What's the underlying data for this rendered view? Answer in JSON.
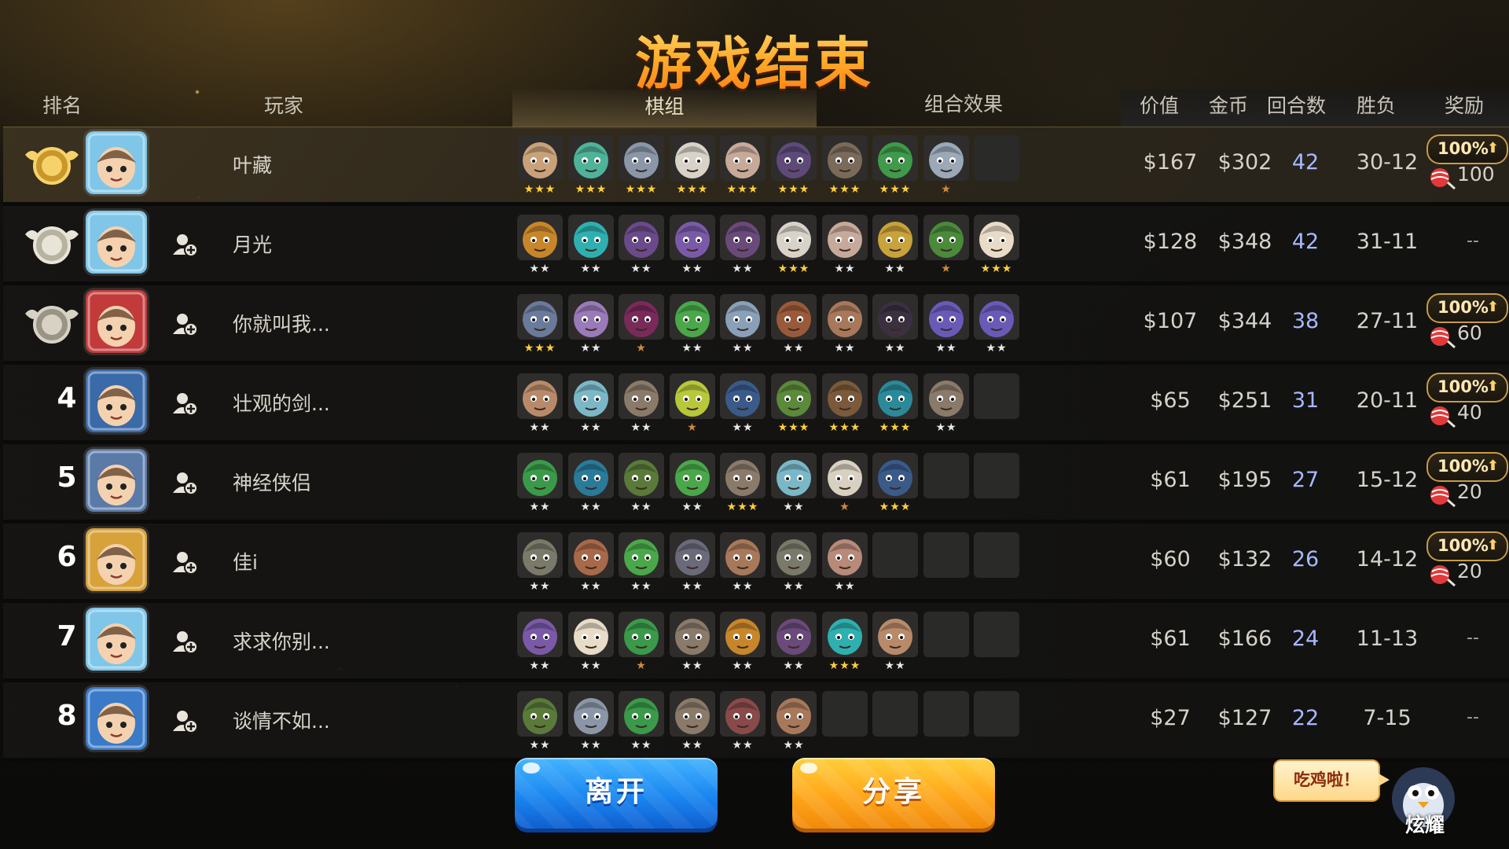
{
  "title": "游戏结束",
  "headers": {
    "rank": "排名",
    "player": "玩家",
    "lineup": "棋组",
    "synergy": "组合效果",
    "value": "价值",
    "gold": "金币",
    "rounds": "回合数",
    "winloss": "胜负",
    "reward": "奖励"
  },
  "colors": {
    "title_orange": "#ffa31e",
    "rounds_blue": "#a8b8ff",
    "star_gold": "#ffcf3a",
    "star_silver": "#e8e8e8",
    "star_bronze": "#d08a3a",
    "leave_blue": "#1a86f0",
    "share_orange": "#ffa61a"
  },
  "players": [
    {
      "rank": "1",
      "medal": "gold",
      "name": "叶藏",
      "value": "$167",
      "gold": "$302",
      "rounds": "42",
      "record": "30-12",
      "reward": {
        "pct": "100%",
        "amount": "100"
      },
      "avatar_color": "#7fc6e8",
      "pieces": [
        {
          "c": "#c9a27a",
          "s": 3
        },
        {
          "c": "#4fb39a",
          "s": 3
        },
        {
          "c": "#8b97a8",
          "s": 3
        },
        {
          "c": "#d8d2c8",
          "s": 3
        },
        {
          "c": "#c7a99a",
          "s": 3
        },
        {
          "c": "#5e4a7a",
          "s": 3
        },
        {
          "c": "#7a6a5a",
          "s": 3
        },
        {
          "c": "#3f9a4a",
          "s": 3
        },
        {
          "c": "#9aa8b8",
          "s": 1
        },
        null
      ]
    },
    {
      "rank": "2",
      "medal": "silver",
      "name": "月光",
      "value": "$128",
      "gold": "$348",
      "rounds": "42",
      "record": "31-11",
      "reward": null,
      "avatar_color": "#7fc6e8",
      "pieces": [
        {
          "c": "#c8862a",
          "s": 2
        },
        {
          "c": "#2fb0b0",
          "s": 2
        },
        {
          "c": "#6a4a8a",
          "s": 2
        },
        {
          "c": "#7a5aa8",
          "s": 2
        },
        {
          "c": "#6a4a7a",
          "s": 2
        },
        {
          "c": "#d8d2c8",
          "s": 3
        },
        {
          "c": "#c7a99a",
          "s": 2
        },
        {
          "c": "#c8a23a",
          "s": 2
        },
        {
          "c": "#4a8a3a",
          "s": 1
        },
        {
          "c": "#e8dcc8",
          "s": 3
        }
      ]
    },
    {
      "rank": "3",
      "medal": "bronze",
      "name": "你就叫我...",
      "value": "$107",
      "gold": "$344",
      "rounds": "38",
      "record": "27-11",
      "reward": {
        "pct": "100%",
        "amount": "60"
      },
      "avatar_color": "#c23a3a",
      "pieces": [
        {
          "c": "#6a7a9a",
          "s": 3
        },
        {
          "c": "#9a7ab8",
          "s": 2
        },
        {
          "c": "#7a2a5a",
          "s": 1
        },
        {
          "c": "#4aa84a",
          "s": 2
        },
        {
          "c": "#8aa0b8",
          "s": 2
        },
        {
          "c": "#9a5a3a",
          "s": 2
        },
        {
          "c": "#a8785a",
          "s": 2
        },
        {
          "c": "#3a3040",
          "s": 2
        },
        {
          "c": "#6a5ab8",
          "s": 2
        },
        {
          "c": "#6a5ab8",
          "s": 2
        }
      ]
    },
    {
      "rank": "4",
      "medal": null,
      "name": "壮观的剑...",
      "value": "$65",
      "gold": "$251",
      "rounds": "31",
      "record": "20-11",
      "reward": {
        "pct": "100%",
        "amount": "40"
      },
      "avatar_color": "#3a6aa8",
      "pieces": [
        {
          "c": "#b88a6a",
          "s": 2
        },
        {
          "c": "#7ab8c8",
          "s": 2
        },
        {
          "c": "#8a7a6a",
          "s": 2
        },
        {
          "c": "#b8c83a",
          "s": 1
        },
        {
          "c": "#3a5a8a",
          "s": 2
        },
        {
          "c": "#5a8a3a",
          "s": 3
        },
        {
          "c": "#7a5a3a",
          "s": 3
        },
        {
          "c": "#2a8a9a",
          "s": 3
        },
        {
          "c": "#8a7a6a",
          "s": 2
        },
        null
      ]
    },
    {
      "rank": "5",
      "medal": null,
      "name": "神经侠侣",
      "value": "$61",
      "gold": "$195",
      "rounds": "27",
      "record": "15-12",
      "reward": {
        "pct": "100%",
        "amount": "20"
      },
      "avatar_color": "#5a7aa8",
      "pieces": [
        {
          "c": "#3a9a4a",
          "s": 2
        },
        {
          "c": "#2a7a9a",
          "s": 2
        },
        {
          "c": "#5a7a3a",
          "s": 2
        },
        {
          "c": "#4aa84a",
          "s": 2
        },
        {
          "c": "#8a7a6a",
          "s": 3
        },
        {
          "c": "#7ab8c8",
          "s": 2
        },
        {
          "c": "#d8d0c0",
          "s": 1
        },
        {
          "c": "#3a5a8a",
          "s": 3
        },
        null,
        null
      ]
    },
    {
      "rank": "6",
      "medal": null,
      "name": "佳i",
      "value": "$60",
      "gold": "$132",
      "rounds": "26",
      "record": "14-12",
      "reward": {
        "pct": "100%",
        "amount": "20"
      },
      "avatar_color": "#d8a23a",
      "pieces": [
        {
          "c": "#7a7a6a",
          "s": 2
        },
        {
          "c": "#a8684a",
          "s": 2
        },
        {
          "c": "#4aa84a",
          "s": 2
        },
        {
          "c": "#6a6a7a",
          "s": 2
        },
        {
          "c": "#a8785a",
          "s": 2
        },
        {
          "c": "#7a7a6a",
          "s": 2
        },
        {
          "c": "#b88a7a",
          "s": 2
        },
        null,
        null,
        null
      ]
    },
    {
      "rank": "7",
      "medal": null,
      "name": "求求你别...",
      "value": "$61",
      "gold": "$166",
      "rounds": "24",
      "record": "11-13",
      "reward": null,
      "avatar_color": "#7fc6e8",
      "pieces": [
        {
          "c": "#7a5aa8",
          "s": 2
        },
        {
          "c": "#e8dcc8",
          "s": 2
        },
        {
          "c": "#3a9a4a",
          "s": 1
        },
        {
          "c": "#8a7a6a",
          "s": 2
        },
        {
          "c": "#c8862a",
          "s": 2
        },
        {
          "c": "#6a4a7a",
          "s": 2
        },
        {
          "c": "#2fb0b0",
          "s": 3
        },
        {
          "c": "#b88a6a",
          "s": 2
        },
        null,
        null
      ]
    },
    {
      "rank": "8",
      "medal": null,
      "name": "谈情不如...",
      "value": "$27",
      "gold": "$127",
      "rounds": "22",
      "record": "7-15",
      "reward": null,
      "avatar_color": "#3a7ac8",
      "pieces": [
        {
          "c": "#5a7a3a",
          "s": 2
        },
        {
          "c": "#8b97a8",
          "s": 2
        },
        {
          "c": "#3a9a4a",
          "s": 2
        },
        {
          "c": "#8a7a6a",
          "s": 2
        },
        {
          "c": "#8a4a4a",
          "s": 2
        },
        {
          "c": "#a8785a",
          "s": 2
        },
        null,
        null,
        null,
        null
      ]
    }
  ],
  "no_reward": "--",
  "buttons": {
    "leave": "离开",
    "share": "分享"
  },
  "bubble": "吃鸡啦！",
  "mascot_label": "炫耀"
}
